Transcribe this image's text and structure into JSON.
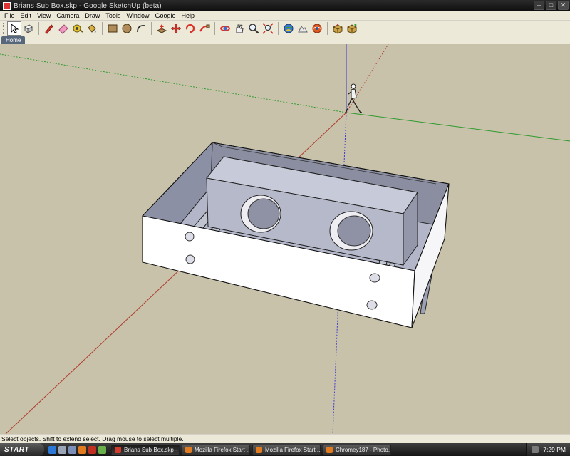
{
  "window": {
    "title": "Brians Sub Box.skp - Google SketchUp (beta)",
    "controls": [
      "minimize",
      "maximize",
      "close"
    ]
  },
  "menu": {
    "items": [
      "File",
      "Edit",
      "View",
      "Camera",
      "Draw",
      "Tools",
      "Window",
      "Google",
      "Help"
    ]
  },
  "toolbar": {
    "tools": [
      {
        "name": "select-icon",
        "active": true
      },
      {
        "name": "make-component-icon"
      },
      {
        "name": "pencil-icon"
      },
      {
        "name": "eraser-icon"
      },
      {
        "name": "tape-measure-icon"
      },
      {
        "name": "paint-bucket-icon"
      },
      {
        "name": "rectangle-icon"
      },
      {
        "name": "circle-icon"
      },
      {
        "name": "arc-icon"
      },
      {
        "name": "push-pull-icon"
      },
      {
        "name": "move-icon"
      },
      {
        "name": "rotate-icon"
      },
      {
        "name": "follow-me-icon"
      },
      {
        "name": "orbit-icon"
      },
      {
        "name": "pan-icon"
      },
      {
        "name": "zoom-icon"
      },
      {
        "name": "zoom-extents-icon"
      },
      {
        "name": "get-current-view-icon"
      },
      {
        "name": "toggle-terrain-icon"
      },
      {
        "name": "place-model-icon"
      },
      {
        "name": "get-models-icon"
      },
      {
        "name": "share-model-icon"
      }
    ]
  },
  "scene_tabs": {
    "items": [
      "Home"
    ]
  },
  "status": {
    "text": "Select objects. Shift to extend select. Drag mouse to select multiple."
  },
  "taskbar": {
    "start_label": "START",
    "tasks": [
      {
        "label": "Brians Sub Box.skp - ...",
        "active": true,
        "color": "#d33c2c"
      },
      {
        "label": "Mozilla Firefox Start ...",
        "active": false,
        "color": "#e07b20"
      },
      {
        "label": "Mozilla Firefox Start ...",
        "active": false,
        "color": "#e07b20"
      },
      {
        "label": "Chromey187 - Photo...",
        "active": false,
        "color": "#e07b20"
      }
    ],
    "clock": "7:29 PM"
  },
  "colors": {
    "viewport_bg": "#c8c2aa",
    "axis_red": "#b03a2e",
    "axis_green": "#2e9a2e",
    "axis_blue": "#3a3ad0"
  }
}
